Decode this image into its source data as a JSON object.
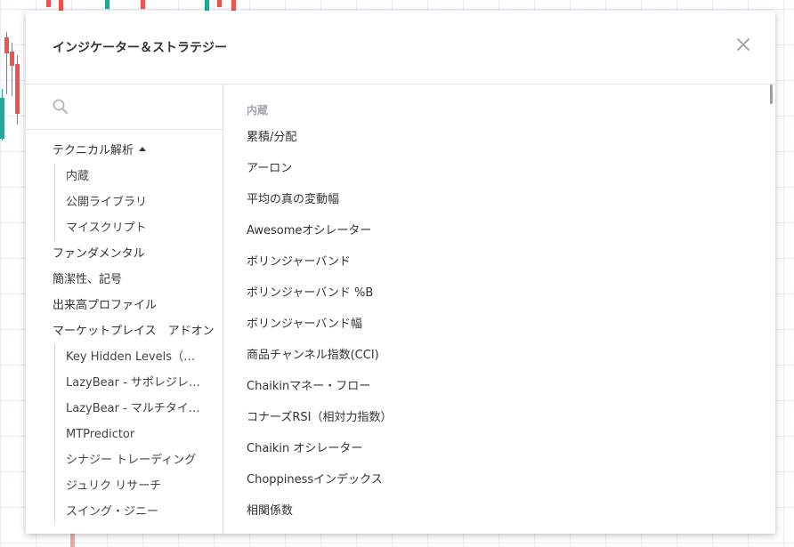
{
  "dialog": {
    "title": "インジケーター＆ストラテジー",
    "close_icon": "close-icon"
  },
  "search": {
    "placeholder": "",
    "value": "",
    "icon": "search-icon"
  },
  "sidebar": {
    "technical": {
      "label": "テクニカル解析"
    },
    "technical_sub": [
      {
        "label": "内蔵"
      },
      {
        "label": "公開ライブラリ"
      },
      {
        "label": "マイスクリプト"
      }
    ],
    "items": [
      {
        "label": "ファンダメンタル"
      },
      {
        "label": "簡潔性、記号"
      },
      {
        "label": "出来高プロファイル"
      },
      {
        "label": "マーケットプレイス　アドオン"
      }
    ],
    "marketplace_sub": [
      {
        "label": "Key Hidden Levels（キーヒドゥンレベル）"
      },
      {
        "label": "LazyBear - サポレジレベル"
      },
      {
        "label": "LazyBear - マルチタイムフレーム"
      },
      {
        "label": "MTPredictor"
      },
      {
        "label": "シナジー トレーディング"
      },
      {
        "label": "ジュリク リサーチ"
      },
      {
        "label": "スイング・ジニー"
      }
    ]
  },
  "content": {
    "section_title": "内蔵",
    "indicators": [
      {
        "label": "累積/分配"
      },
      {
        "label": "アーロン"
      },
      {
        "label": "平均の真の変動幅"
      },
      {
        "label": "Awesomeオシレーター"
      },
      {
        "label": "ボリンジャーバンド"
      },
      {
        "label": "ボリンジャーバンド %B"
      },
      {
        "label": "ボリンジャーバンド幅"
      },
      {
        "label": "商品チャンネル指数(CCI)"
      },
      {
        "label": "Chaikinマネー・フロー"
      },
      {
        "label": "コナーズRSI（相対力指数）"
      },
      {
        "label": "Chaikin オシレーター"
      },
      {
        "label": "Choppinessインデックス"
      },
      {
        "label": "相関係数"
      }
    ]
  },
  "colors": {
    "up_candle": "#26a69a",
    "down_candle": "#ef5350",
    "section_title": "#a3a6af"
  }
}
